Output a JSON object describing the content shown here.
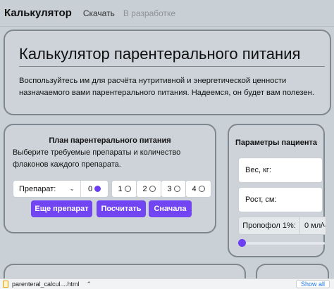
{
  "navbar": {
    "brand": "Калькулятор",
    "links": [
      {
        "label": "Скачать",
        "disabled": false
      },
      {
        "label": "В разработке",
        "disabled": true
      }
    ]
  },
  "hero": {
    "title": "Калькулятор парентерального питания",
    "text": "Воспользуйтесь им для расчёта нутритивной и энергетической ценности назначаемого вами парентерального питания. Надеемся, он будет вам полезен."
  },
  "plan": {
    "title": "План парентерального питания",
    "description": "Выберите требуемые препараты и количество флаконов каждого препарата.",
    "prep_select": "Препарат:",
    "radio_options": [
      "0",
      "1",
      "2",
      "3",
      "4"
    ],
    "selected_option": "0",
    "buttons": {
      "more": "Еще препарат",
      "calculate": "Посчитать",
      "reset": "Сначала"
    }
  },
  "params": {
    "title": "Параметры пациента",
    "weight_placeholder": "Вес, кг:",
    "height_placeholder": "Рост, см:",
    "propofol_label": "Пропофол 1%:",
    "propofol_value": "0 мл/ч",
    "propofol_slider_fraction": 0
  },
  "download_bar": {
    "file_name": "parenteral_calcul....html",
    "show_all": "Show all"
  },
  "colors": {
    "accent": "#7245f2",
    "background": "#c9d0d6",
    "card_border": "#7f8790"
  }
}
